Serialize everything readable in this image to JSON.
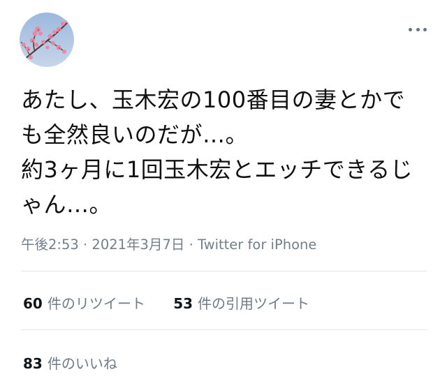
{
  "tweet": {
    "avatar_icon": "cherry-blossom-avatar",
    "more_icon": "more-options-icon",
    "lines": [
      "あたし、玉木宏の100番目の妻とかで",
      "も全然良いのだが…。",
      "約3ヶ月に1回玉木宏とエッチできるじ",
      "ゃん…。"
    ],
    "time": "午後2:53",
    "separator": "·",
    "date": "2021年3月7日",
    "source": "Twitter for iPhone"
  },
  "stats": {
    "retweets": {
      "count": "60",
      "label": "件のリツイート"
    },
    "quotes": {
      "count": "53",
      "label": "件の引用ツイート"
    },
    "likes": {
      "count": "83",
      "label": "件のいいね"
    }
  },
  "colors": {
    "text": "#111111",
    "meta": "#72808c",
    "divider": "#e2e6ea"
  }
}
